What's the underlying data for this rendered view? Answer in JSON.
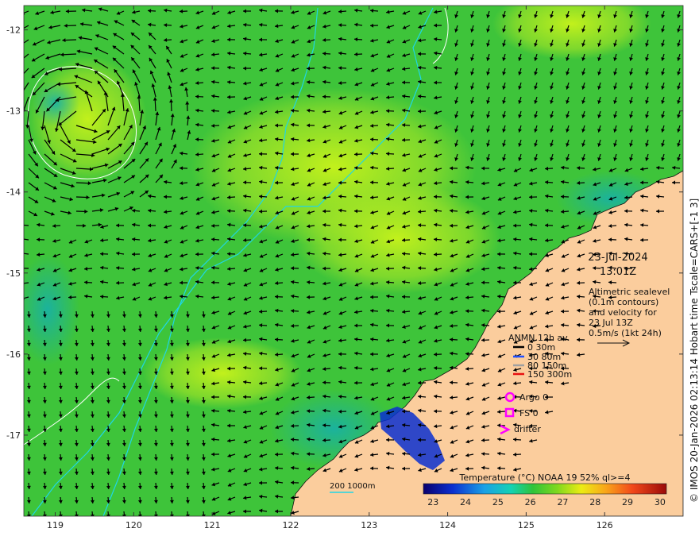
{
  "date": "23-Jul-2024",
  "time": "13:01Z",
  "description": [
    "Altimetric sealevel",
    "(0.1m contours)",
    "and velocity for",
    "23 Jul 13Z",
    "0.5m/s (1kt 24h)"
  ],
  "legend": {
    "title": "ANMN 12h av.",
    "items": [
      {
        "label": "0 30m",
        "color": "#000000"
      },
      {
        "label": "30 80m",
        "color": "#1f4fff"
      },
      {
        "label": "80 150m",
        "color": "#a0a0a0"
      },
      {
        "label": "150 300m",
        "color": "#e81010"
      }
    ]
  },
  "markers": [
    {
      "label": "Argo 0",
      "symbol": "circle",
      "color": "#ff00ff"
    },
    {
      "label": "FS 0",
      "symbol": "square",
      "color": "#ff00ff"
    },
    {
      "label": "drifter",
      "symbol": "chevron",
      "color": "#ff00ff"
    }
  ],
  "isobath_label": "200  1000m",
  "colorbar": {
    "title": "Temperature (°C) NOAA 19 52% ql>=4",
    "ticks": [
      "23",
      "24",
      "25",
      "26",
      "27",
      "28",
      "29",
      "30"
    ],
    "min": 22.7,
    "max": 30.2
  },
  "side_text": "© IMOS 20-Jan-2026 02:13:14 Hobart time Tscale=CARS+[-1 3]",
  "x_ticks": [
    "119",
    "120",
    "121",
    "122",
    "123",
    "124",
    "125",
    "126"
  ],
  "y_ticks": [
    "-12",
    "-13",
    "-14",
    "-15",
    "-16",
    "-17"
  ],
  "extent": {
    "lon_min": 118.6,
    "lon_max": 127.0,
    "lat_top": -11.7,
    "lat_bottom": -18.0
  },
  "colors": {
    "land": "#fbcd9d",
    "sea_base": "#3ec43a",
    "sea_warm": "#c6f01a",
    "sea_cool": "#0f9fbd",
    "isobath": "#1fd6e6",
    "contour": "#ffffff"
  }
}
